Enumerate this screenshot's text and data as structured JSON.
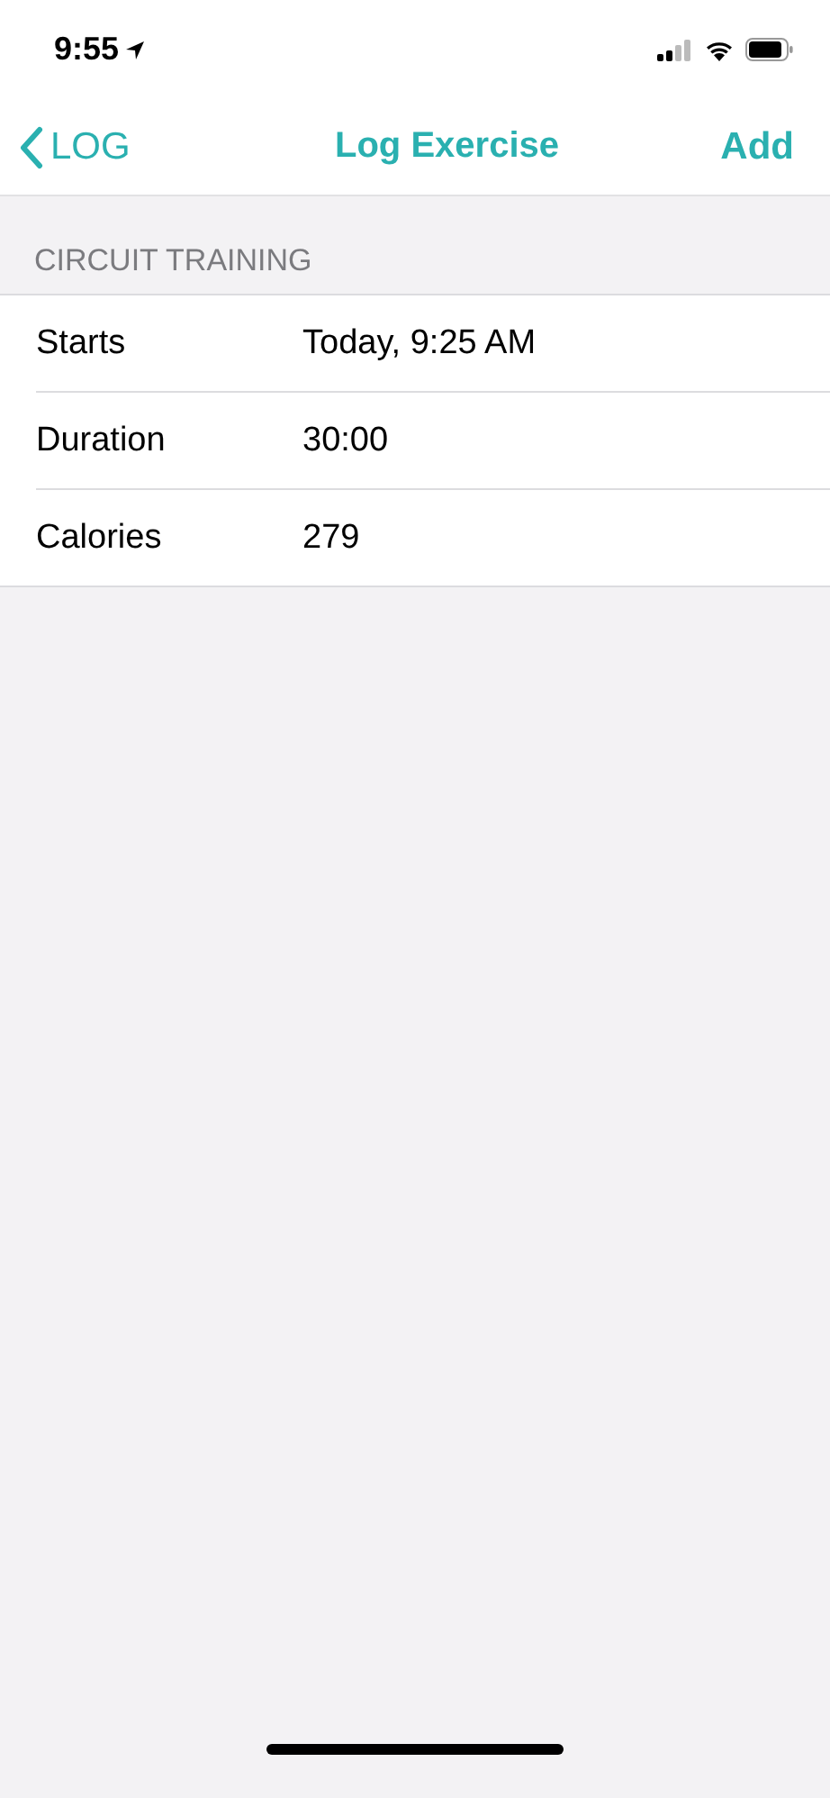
{
  "status_bar": {
    "time": "9:55"
  },
  "nav_bar": {
    "back": "LOG",
    "title": "Log Exercise",
    "action": "Add"
  },
  "section": {
    "header": "CIRCUIT TRAINING",
    "rows": [
      {
        "label": "Starts",
        "value": "Today, 9:25 AM"
      },
      {
        "label": "Duration",
        "value": "30:00"
      },
      {
        "label": "Calories",
        "value": "279"
      }
    ]
  }
}
